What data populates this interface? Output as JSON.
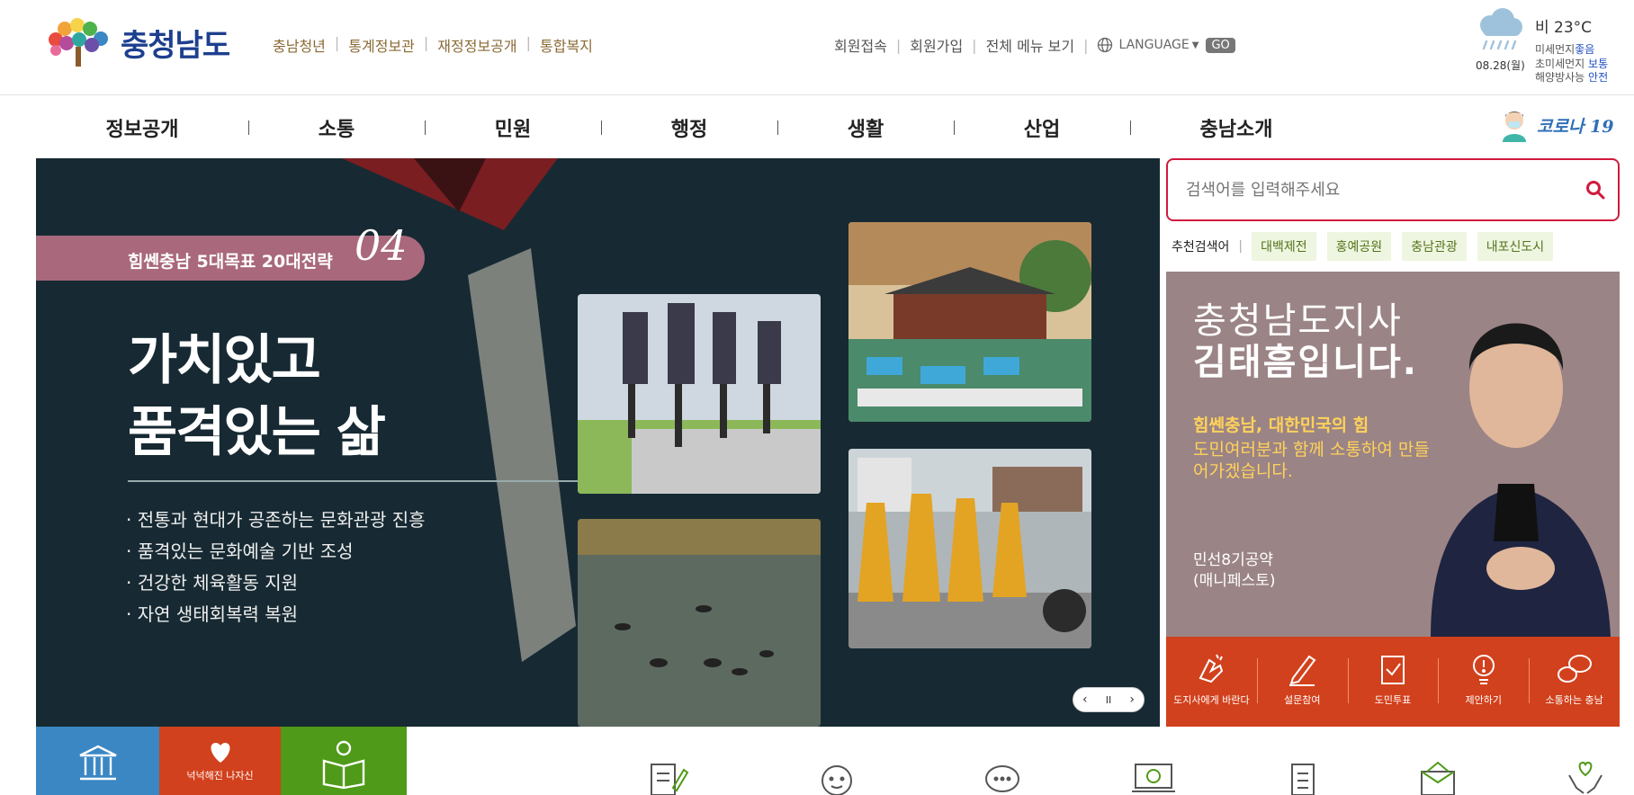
{
  "header": {
    "logo_text": "충청남도",
    "links": [
      "충남청년",
      "통계정보관",
      "재정정보공개",
      "통합복지"
    ],
    "util_links": [
      "회원접속",
      "회원가입",
      "전체 메뉴 보기"
    ],
    "language_label": "LANGUAGE",
    "go_label": "GO"
  },
  "weather": {
    "condition_temp": "비 23°C",
    "date": "08.28(월)",
    "lines": [
      {
        "label": "미세먼지",
        "value": "좋음"
      },
      {
        "label": "초미세먼지",
        "value": "보통"
      },
      {
        "label": "해양방사능",
        "value": "안전"
      }
    ]
  },
  "nav": {
    "items": [
      "정보공개",
      "소통",
      "민원",
      "행정",
      "생활",
      "산업",
      "충남소개"
    ],
    "corona_label": "코로나 19"
  },
  "banner": {
    "tag": "힘쎈충남 5대목표 20대전략",
    "tag_number": "04",
    "headline_1": "가치있고",
    "headline_2": "품격있는 삶",
    "bullets": [
      "· 전통과 현대가 공존하는 문화관광 진흥",
      "· 품격있는 문화예술 기반 조성",
      "· 건강한 체육활동 지원",
      "· 자연 생태회복력 복원"
    ],
    "controls": {
      "prev": "‹",
      "pause": "II",
      "next": "›"
    }
  },
  "search": {
    "placeholder": "검색어를 입력해주세요",
    "recommend_label": "추천검색어",
    "keywords": [
      "대백제전",
      "홍예공원",
      "충남관광",
      "내포신도시"
    ]
  },
  "governor": {
    "line1": "충청남도지사",
    "line2": "김태흠입니다.",
    "slogan": "힘쎈충남, 대한민국의 힘",
    "message": "도민여러분과 함께 소통하여 만들어가겠습니다.",
    "pledge_1": "민선8기공약",
    "pledge_2": "(매니페스토)"
  },
  "services": [
    "도지사에게 바란다",
    "설문참여",
    "도민투표",
    "제안하기",
    "소통하는 충남"
  ],
  "tiles": [
    {
      "label": "",
      "color": "#3a87c4"
    },
    {
      "label": "넉넉해진 나자신",
      "color": "#d2411d"
    },
    {
      "label": "",
      "color": "#4f9a18"
    }
  ],
  "colors": {
    "brand": "#1d3f8f",
    "accent": "#d01a3e",
    "service": "#d2411d"
  }
}
